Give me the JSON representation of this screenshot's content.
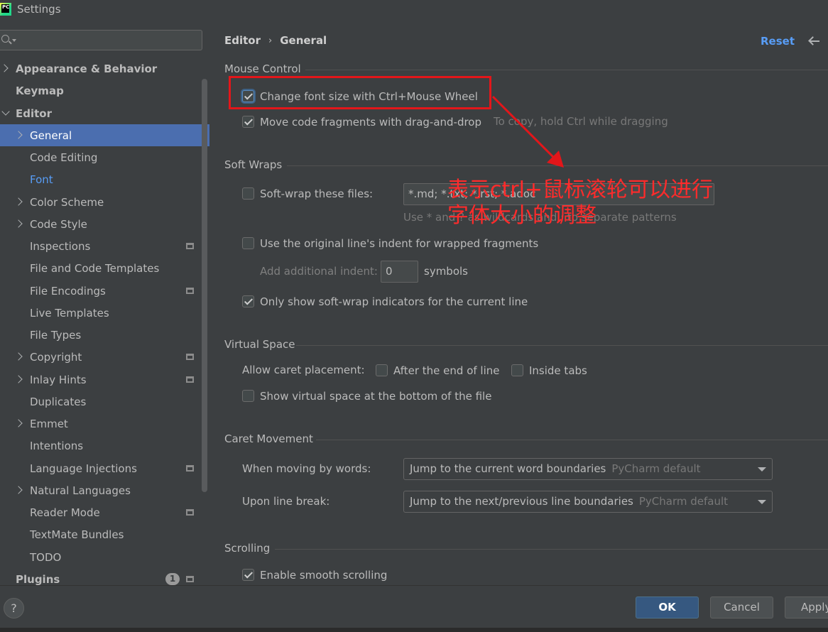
{
  "window": {
    "title": "Settings",
    "logo_text": "PC"
  },
  "search": {
    "value": "",
    "placeholder": ""
  },
  "sidebar": {
    "items": [
      {
        "label": "Appearance & Behavior",
        "bold": true,
        "expand": "right"
      },
      {
        "label": "Keymap",
        "bold": true,
        "expand": "none"
      },
      {
        "label": "Editor",
        "bold": true,
        "expand": "down"
      },
      {
        "label": "General",
        "bold": false,
        "expand": "right",
        "selected": true
      },
      {
        "label": "Code Editing",
        "bold": false,
        "expand": "none"
      },
      {
        "label": "Font",
        "bold": false,
        "expand": "none",
        "link": true
      },
      {
        "label": "Color Scheme",
        "bold": false,
        "expand": "right"
      },
      {
        "label": "Code Style",
        "bold": false,
        "expand": "right"
      },
      {
        "label": "Inspections",
        "bold": false,
        "expand": "none",
        "project": true
      },
      {
        "label": "File and Code Templates",
        "bold": false,
        "expand": "none"
      },
      {
        "label": "File Encodings",
        "bold": false,
        "expand": "none",
        "project": true
      },
      {
        "label": "Live Templates",
        "bold": false,
        "expand": "none"
      },
      {
        "label": "File Types",
        "bold": false,
        "expand": "none"
      },
      {
        "label": "Copyright",
        "bold": false,
        "expand": "right",
        "project": true
      },
      {
        "label": "Inlay Hints",
        "bold": false,
        "expand": "right",
        "project": true
      },
      {
        "label": "Duplicates",
        "bold": false,
        "expand": "none"
      },
      {
        "label": "Emmet",
        "bold": false,
        "expand": "right"
      },
      {
        "label": "Intentions",
        "bold": false,
        "expand": "none"
      },
      {
        "label": "Language Injections",
        "bold": false,
        "expand": "none",
        "project": true
      },
      {
        "label": "Natural Languages",
        "bold": false,
        "expand": "right"
      },
      {
        "label": "Reader Mode",
        "bold": false,
        "expand": "none",
        "project": true
      },
      {
        "label": "TextMate Bundles",
        "bold": false,
        "expand": "none"
      },
      {
        "label": "TODO",
        "bold": false,
        "expand": "none"
      },
      {
        "label": "Plugins",
        "bold": true,
        "expand": "none",
        "project": true,
        "badge": "1"
      }
    ]
  },
  "header": {
    "crumb_parent": "Editor",
    "crumb_sep": "›",
    "crumb_current": "General",
    "reset_label": "Reset"
  },
  "mouse_control": {
    "title": "Mouse Control",
    "change_font_size": {
      "label": "Change font size with Ctrl+Mouse Wheel",
      "checked": true
    },
    "move_fragments": {
      "label": "Move code fragments with drag-and-drop",
      "checked": true,
      "hint": "To copy, hold Ctrl while dragging"
    }
  },
  "soft_wraps": {
    "title": "Soft Wraps",
    "soft_wrap_files": {
      "label": "Soft-wrap these files:",
      "checked": false,
      "value": "*.md; *.txt; *.rst; *.adoc",
      "hint": "Use * and ? as wildcards and ; to separate patterns"
    },
    "original_indent": {
      "label": "Use the original line's indent for wrapped fragments",
      "checked": false
    },
    "additional_indent": {
      "label": "Add additional indent:",
      "value": "0",
      "unit": "symbols"
    },
    "only_current_line": {
      "label": "Only show soft-wrap indicators for the current line",
      "checked": true
    }
  },
  "virtual_space": {
    "title": "Virtual Space",
    "allow_caret_label": "Allow caret placement:",
    "after_end_of_line": {
      "label": "After the end of line",
      "checked": false
    },
    "inside_tabs": {
      "label": "Inside tabs",
      "checked": false
    },
    "show_virtual_bottom": {
      "label": "Show virtual space at the bottom of the file",
      "checked": false
    }
  },
  "caret_movement": {
    "title": "Caret Movement",
    "by_words": {
      "label": "When moving by words:",
      "value": "Jump to the current word boundaries",
      "default": "PyCharm default"
    },
    "line_break": {
      "label": "Upon line break:",
      "value": "Jump to the next/previous line boundaries",
      "default": "PyCharm default"
    }
  },
  "scrolling": {
    "title": "Scrolling",
    "smooth": {
      "label": "Enable smooth scrolling",
      "checked": true
    }
  },
  "annotation": {
    "line1": "表示ctrl+鼠标滚轮可以进行",
    "line2": "字体大小的调整",
    "color": "#ff2b2b"
  },
  "footer": {
    "help_label": "?",
    "ok_label": "OK",
    "cancel_label": "Cancel",
    "apply_label": "Apply"
  },
  "colors": {
    "background": "#3c3f41",
    "selection": "#4b6eaf",
    "link": "#589df6",
    "primary_button": "#365880"
  }
}
